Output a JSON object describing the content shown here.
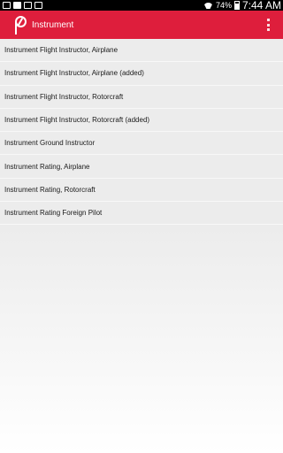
{
  "status_bar": {
    "battery_percent": "74%",
    "time": "7:44 AM",
    "icons_left": [
      "notification-icon",
      "image-icon",
      "mail-icon",
      "bag-icon"
    ]
  },
  "app_bar": {
    "title": "Instrument",
    "color": "#de1e3c"
  },
  "items": [
    {
      "label": "Instrument Flight Instructor, Airplane"
    },
    {
      "label": "Instrument Flight Instructor, Airplane (added)"
    },
    {
      "label": "Instrument Flight Instructor, Rotorcraft"
    },
    {
      "label": "Instrument Flight Instructor, Rotorcraft (added)"
    },
    {
      "label": "Instrument Ground Instructor"
    },
    {
      "label": "Instrument Rating, Airplane"
    },
    {
      "label": "Instrument Rating, Rotorcraft"
    },
    {
      "label": "Instrument Rating Foreign Pilot"
    }
  ]
}
